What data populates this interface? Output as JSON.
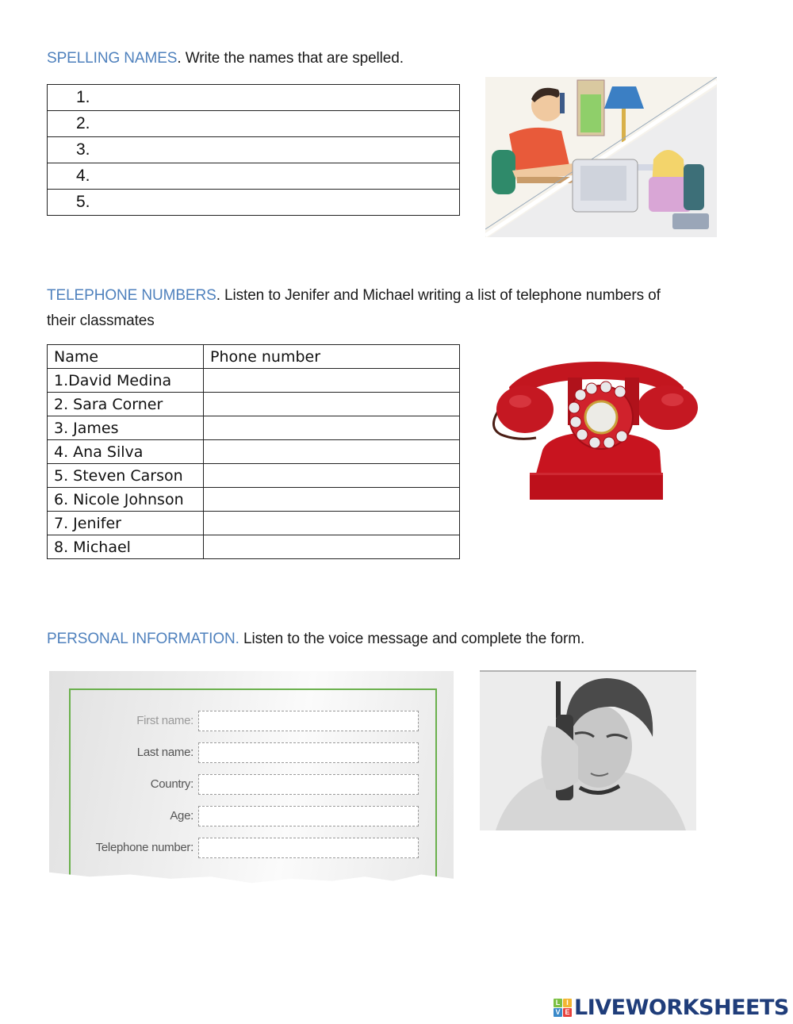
{
  "sections": {
    "spelling": {
      "heading": "SPELLING NAMES",
      "instruction": ". Write the names that are spelled.",
      "rows": [
        "1.",
        "2.",
        "3.",
        "4.",
        "5."
      ],
      "image": "man-and-woman-on-phone-illustration"
    },
    "telephone": {
      "heading": "TELEPHONE NUMBERS",
      "instruction_line1": ". Listen to Jenifer and Michael writing a list of telephone numbers of",
      "instruction_line2": "their classmates",
      "columns": [
        "Name",
        "Phone number"
      ],
      "rows": [
        {
          "name": "1.David Medina",
          "phone": ""
        },
        {
          "name": "2. Sara Corner",
          "phone": ""
        },
        {
          "name": "3. James",
          "phone": ""
        },
        {
          "name": "4. Ana Silva",
          "phone": ""
        },
        {
          "name": "5. Steven Carson",
          "phone": ""
        },
        {
          "name": "6. Nicole Johnson",
          "phone": ""
        },
        {
          "name": "7. Jenifer",
          "phone": ""
        },
        {
          "name": "8. Michael",
          "phone": ""
        }
      ],
      "image": "red-rotary-telephone"
    },
    "personal": {
      "heading": "PERSONAL INFORMATION.",
      "instruction": " Listen to the voice message and complete the form.",
      "fields": [
        {
          "label": "First name:",
          "value": ""
        },
        {
          "label": "Last name:",
          "value": ""
        },
        {
          "label": "Country:",
          "value": ""
        },
        {
          "label": "Age:",
          "value": ""
        },
        {
          "label": "Telephone number:",
          "value": ""
        }
      ],
      "image": "young-man-on-cell-phone-photo"
    }
  },
  "colors": {
    "heading": "#4f81bd",
    "form_border": "#6ab04c",
    "logo_text": "#1f3d7a",
    "phone_red": "#c8102e"
  },
  "logo": {
    "badge": [
      "L",
      "I",
      "V",
      "E"
    ],
    "text": "LIVEWORKSHEETS"
  }
}
